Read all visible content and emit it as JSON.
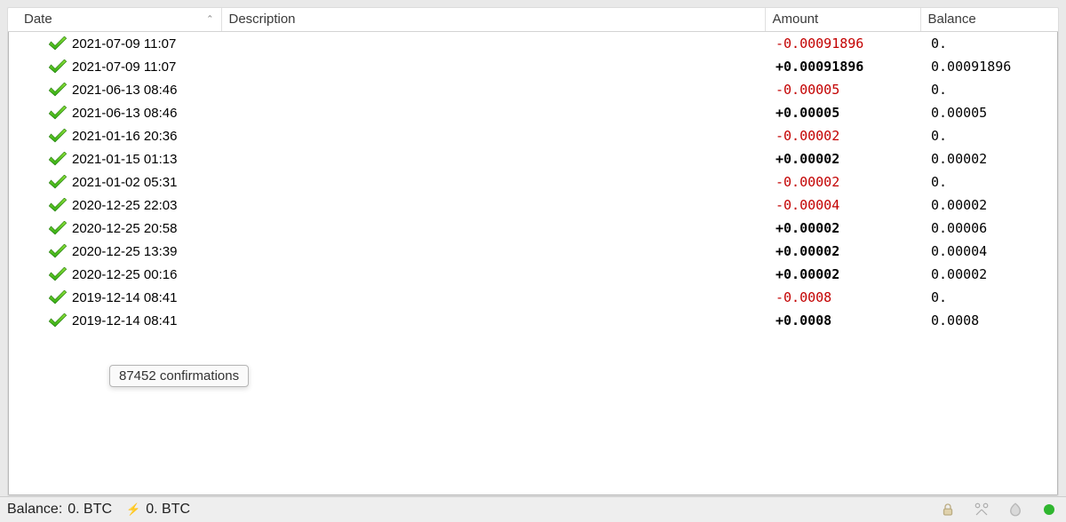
{
  "columns": {
    "date": "Date",
    "description": "Description",
    "amount": "Amount",
    "balance": "Balance",
    "sort_indicator": "⌃"
  },
  "transactions": [
    {
      "date": "2021-07-09 11:07",
      "description": "",
      "amount": "-0.00091896",
      "balance": "0.",
      "sign": "neg"
    },
    {
      "date": "2021-07-09 11:07",
      "description": "",
      "amount": "+0.00091896",
      "balance": "0.00091896",
      "sign": "pos"
    },
    {
      "date": "2021-06-13 08:46",
      "description": "",
      "amount": "-0.00005",
      "balance": "0.",
      "sign": "neg"
    },
    {
      "date": "2021-06-13 08:46",
      "description": "",
      "amount": "+0.00005",
      "balance": "0.00005",
      "sign": "pos"
    },
    {
      "date": "2021-01-16 20:36",
      "description": "",
      "amount": "-0.00002",
      "balance": "0.",
      "sign": "neg"
    },
    {
      "date": "2021-01-15 01:13",
      "description": "",
      "amount": "+0.00002",
      "balance": "0.00002",
      "sign": "pos"
    },
    {
      "date": "2021-01-02 05:31",
      "description": "",
      "amount": "-0.00002",
      "balance": "0.",
      "sign": "neg"
    },
    {
      "date": "2020-12-25 22:03",
      "description": "",
      "amount": "-0.00004",
      "balance": "0.00002",
      "sign": "neg"
    },
    {
      "date": "2020-12-25 20:58",
      "description": "",
      "amount": "+0.00002",
      "balance": "0.00006",
      "sign": "pos"
    },
    {
      "date": "2020-12-25 13:39",
      "description": "",
      "amount": "+0.00002",
      "balance": "0.00004",
      "sign": "pos"
    },
    {
      "date": "2020-12-25 00:16",
      "description": "",
      "amount": "+0.00002",
      "balance": "0.00002",
      "sign": "pos"
    },
    {
      "date": "2019-12-14 08:41",
      "description": "",
      "amount": "-0.0008",
      "balance": "0.",
      "sign": "neg"
    },
    {
      "date": "2019-12-14 08:41",
      "description": "",
      "amount": "+0.0008",
      "balance": "0.0008",
      "sign": "pos"
    }
  ],
  "tooltip": "87452 confirmations",
  "statusbar": {
    "balance_label": "Balance:",
    "balance_value": "0. BTC",
    "lightning_symbol": "⚡",
    "lightning_value": "0. BTC"
  },
  "icons": {
    "confirm_icon_name": "confirmed-checkmark-icon",
    "lock_icon_name": "lock-icon",
    "tools_icon_name": "tools-icon",
    "seed_icon_name": "seed-icon",
    "network_icon_name": "network-status-icon"
  }
}
